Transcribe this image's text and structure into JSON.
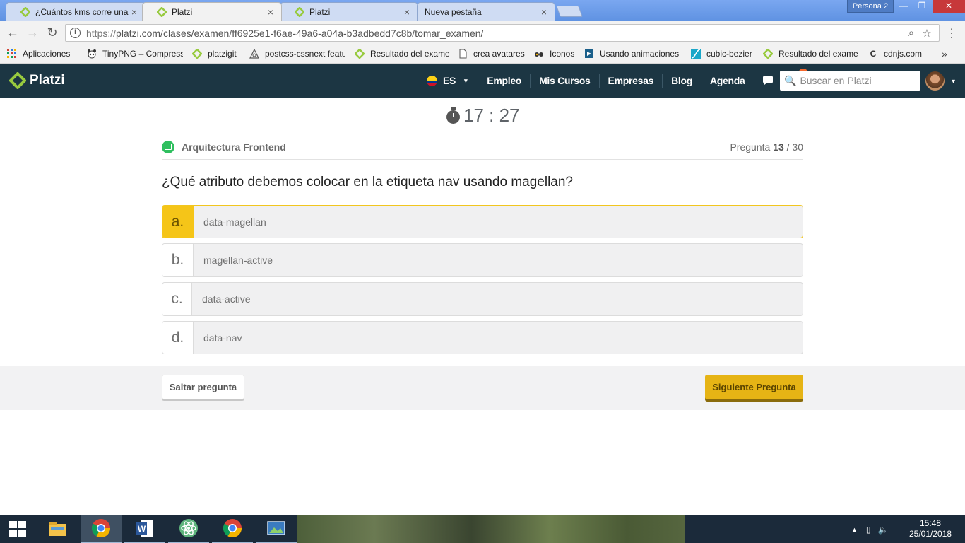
{
  "browser": {
    "tabs": [
      {
        "title": "¿Cuántos kms corre una p",
        "favicon": "platzi-icon",
        "active": false
      },
      {
        "title": "Platzi",
        "favicon": "platzi-icon",
        "active": true
      },
      {
        "title": "Platzi",
        "favicon": "platzi-icon",
        "active": false
      },
      {
        "title": "Nueva pestaña",
        "favicon": "",
        "active": false
      }
    ],
    "profile": "Persona 2",
    "url_protocol": "https://",
    "url_rest": "platzi.com/clases/examen/ff6925e1-f6ae-49a6-a04a-b3adbedd7c8b/tomar_examen/",
    "bookmarks": [
      {
        "title": "Aplicaciones",
        "icon": "apps-grid-icon"
      },
      {
        "title": "TinyPNG – Compress",
        "icon": "panda-icon"
      },
      {
        "title": "platzigit",
        "icon": "platzi-icon"
      },
      {
        "title": "postcss-cssnext featu",
        "icon": "postcss-icon"
      },
      {
        "title": "Resultado del exame",
        "icon": "platzi-icon"
      },
      {
        "title": "crea avatares",
        "icon": "page-icon"
      },
      {
        "title": "Iconos",
        "icon": "glasses-icon"
      },
      {
        "title": "Usando animaciones",
        "icon": "scroll-icon"
      },
      {
        "title": "cubic-bezier",
        "icon": "curve-icon"
      },
      {
        "title": "Resultado del exame",
        "icon": "platzi-icon"
      },
      {
        "title": "cdnjs.com",
        "icon": "c-icon"
      }
    ],
    "bookmarks_more": "»"
  },
  "header": {
    "logo": "Platzi",
    "lang": "ES",
    "nav": [
      "Empleo",
      "Mis Cursos",
      "Empresas",
      "Blog",
      "Agenda"
    ],
    "notification_count": "1",
    "search_placeholder": "Buscar en Platzi"
  },
  "exam": {
    "timer": "17 : 27",
    "course": "Arquitectura Frontend",
    "progress_label": "Pregunta",
    "progress_current": "13",
    "progress_total": "/ 30",
    "question": "¿Qué atributo debemos colocar en la etiqueta nav usando magellan?",
    "options": [
      {
        "letter": "a.",
        "text": "data-magellan",
        "selected": true
      },
      {
        "letter": "b.",
        "text": "magellan-active",
        "selected": false
      },
      {
        "letter": "c.",
        "text": "data-active",
        "selected": false
      },
      {
        "letter": "d.",
        "text": "data-nav",
        "selected": false
      }
    ],
    "skip_label": "Saltar pregunta",
    "next_label": "Siguiente Pregunta"
  },
  "taskbar": {
    "apps": [
      "file-explorer-icon",
      "chrome-icon",
      "word-icon",
      "atom-icon",
      "chrome-icon",
      "photos-icon"
    ],
    "time": "15:48",
    "date": "25/01/2018"
  },
  "colors": {
    "header_bg": "#1c3643",
    "selected_option": "#f5c518",
    "next_button": "#e6b415",
    "platzi_green": "#98ca3f"
  }
}
